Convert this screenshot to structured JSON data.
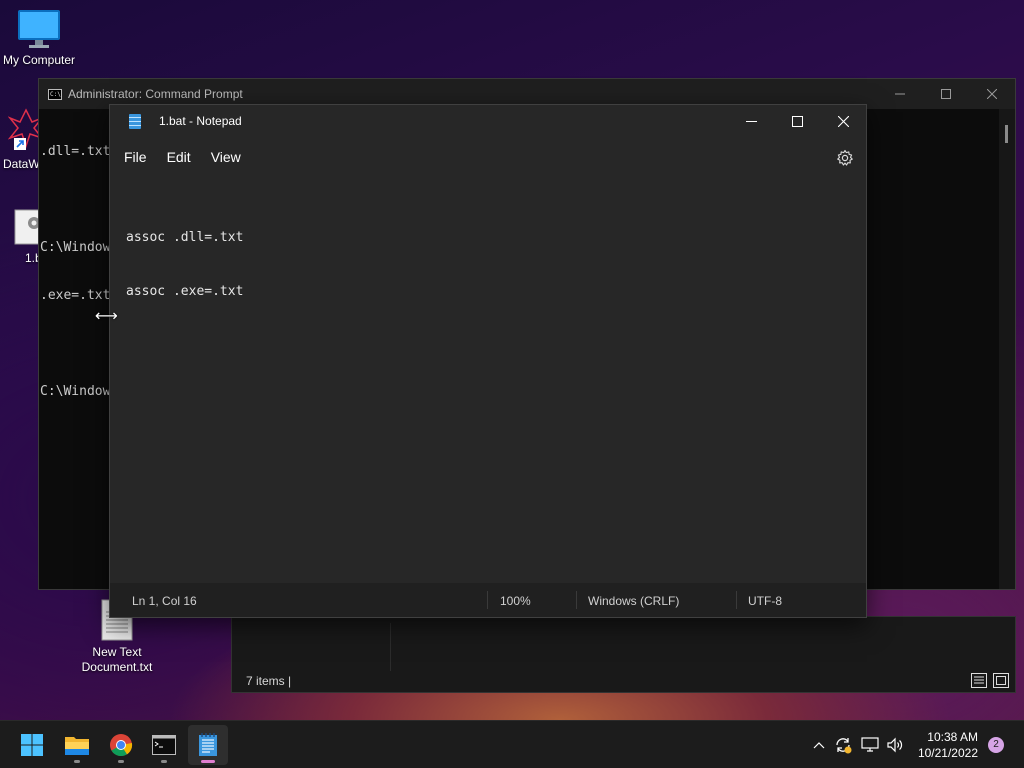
{
  "desktop": {
    "icons": [
      {
        "label": "My Computer"
      },
      {
        "label": "DataW"
      },
      {
        "label": "1.b"
      },
      {
        "label": "New Text Document.txt"
      }
    ]
  },
  "cmd": {
    "title": "Administrator: Command Prompt",
    "lines": [
      ".dll=.txt",
      "",
      "C:\\Window",
      ".exe=.txt",
      "",
      "C:\\Window"
    ]
  },
  "explorer": {
    "status": "7 items  |"
  },
  "notepad": {
    "title": "1.bat - Notepad",
    "menu": [
      "File",
      "Edit",
      "View"
    ],
    "content": [
      "assoc .dll=.txt",
      "assoc .exe=.txt"
    ],
    "status": {
      "position": "Ln 1, Col 16",
      "zoom": "100%",
      "line_ending": "Windows (CRLF)",
      "encoding": "UTF-8"
    }
  },
  "taskbar": {
    "apps": [
      "start-icon",
      "file-explorer-icon",
      "chrome-icon",
      "terminal-icon",
      "notepad-icon"
    ],
    "time": "10:38 AM",
    "date": "10/21/2022",
    "notification_count": "2"
  }
}
